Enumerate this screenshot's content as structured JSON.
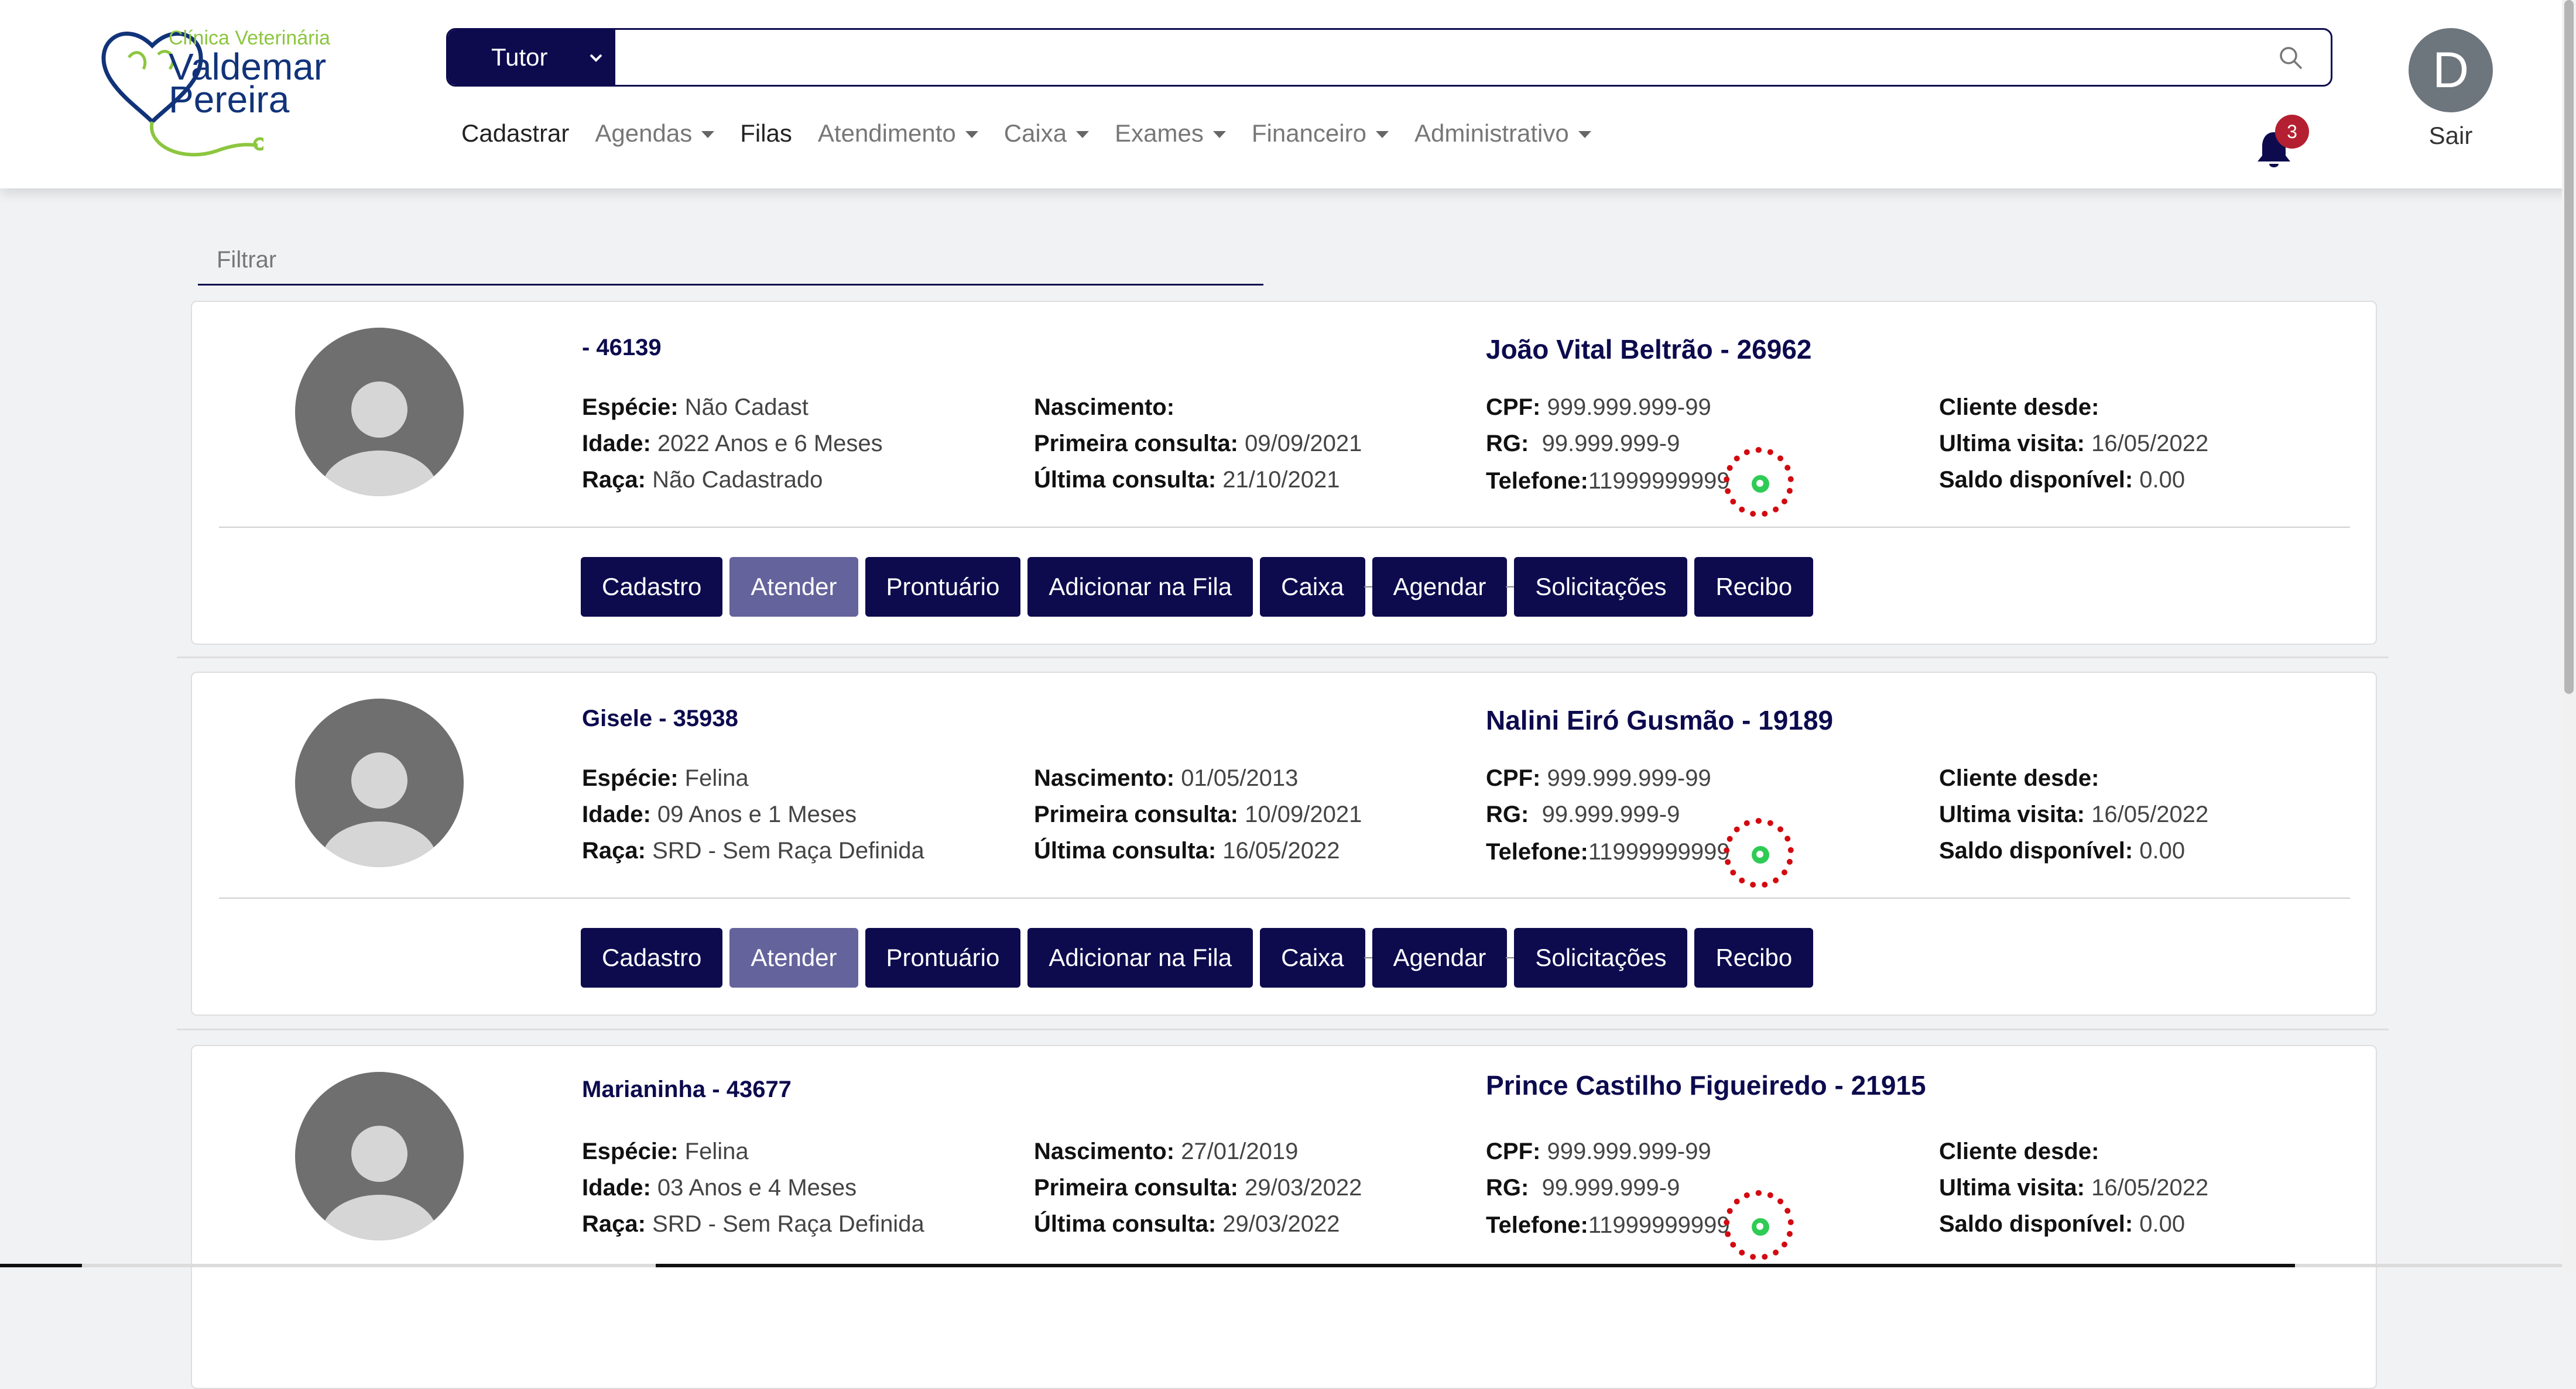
{
  "header": {
    "logo_top": "Clínica Veterinária",
    "logo_line1": "Valdemar",
    "logo_line2": "Pereira",
    "search_select": "Tutor",
    "search_placeholder": "",
    "notifications_count": "3",
    "avatar_letter": "D",
    "logout_label": "Sair"
  },
  "nav": {
    "items": [
      {
        "label": "Cadastrar"
      },
      {
        "label": "Agendas"
      },
      {
        "label": "Filas"
      },
      {
        "label": "Atendimento"
      },
      {
        "label": "Caixa"
      },
      {
        "label": "Exames"
      },
      {
        "label": "Financeiro"
      },
      {
        "label": "Administrativo"
      }
    ]
  },
  "filter": {
    "placeholder": "Filtrar"
  },
  "labels": {
    "especie": "Espécie:",
    "idade": "Idade:",
    "raca": "Raça:",
    "nascimento": "Nascimento:",
    "primeira": "Primeira consulta:",
    "ultima": "Última consulta:",
    "cpf": "CPF:",
    "rg": "RG:",
    "telefone": "Telefone:",
    "cliente_desde": "Cliente desde:",
    "ultima_visita": "Ultima visita:",
    "saldo": "Saldo disponível:"
  },
  "buttons": {
    "cadastro": "Cadastro",
    "atender": "Atender",
    "prontuario": "Prontuário",
    "fila": "Adicionar na Fila",
    "caixa": "Caixa",
    "agendar": "Agendar",
    "solicitacoes": "Solicitações",
    "recibo": "Recibo"
  },
  "cards": [
    {
      "pet_title": "- 46139",
      "tutor_title": "João Vital Beltrão - 26962",
      "especie": "Não Cadast",
      "idade": "2022 Anos e 6 Meses",
      "raca": "Não Cadastrado",
      "nascimento": "",
      "primeira_consulta": "09/09/2021",
      "ultima_consulta": "21/10/2021",
      "cpf": "999.999.999-99",
      "rg": "99.999.999-9",
      "telefone": "11999999999",
      "cliente_desde": "",
      "ultima_visita": "16/05/2022",
      "saldo": "0.00"
    },
    {
      "pet_title": "Gisele - 35938",
      "tutor_title": "Nalini Eiró Gusmão - 19189",
      "especie": "Felina",
      "idade": "09 Anos e 1 Meses",
      "raca": "SRD - Sem Raça Definida",
      "nascimento": "01/05/2013",
      "primeira_consulta": "10/09/2021",
      "ultima_consulta": "16/05/2022",
      "cpf": "999.999.999-99",
      "rg": "99.999.999-9",
      "telefone": "11999999999",
      "cliente_desde": "",
      "ultima_visita": "16/05/2022",
      "saldo": "0.00"
    },
    {
      "pet_title": "Marianinha - 43677",
      "tutor_title": "Prince Castilho Figueiredo - 21915",
      "especie": "Felina",
      "idade": "03 Anos e 4 Meses",
      "raca": "SRD - Sem Raça Definida",
      "nascimento": "27/01/2019",
      "primeira_consulta": "29/03/2022",
      "ultima_consulta": "29/03/2022",
      "cpf": "999.999.999-99",
      "rg": "99.999.999-9",
      "telefone": "11999999999",
      "cliente_desde": "",
      "ultima_visita": "16/05/2022",
      "saldo": "0.00"
    }
  ]
}
